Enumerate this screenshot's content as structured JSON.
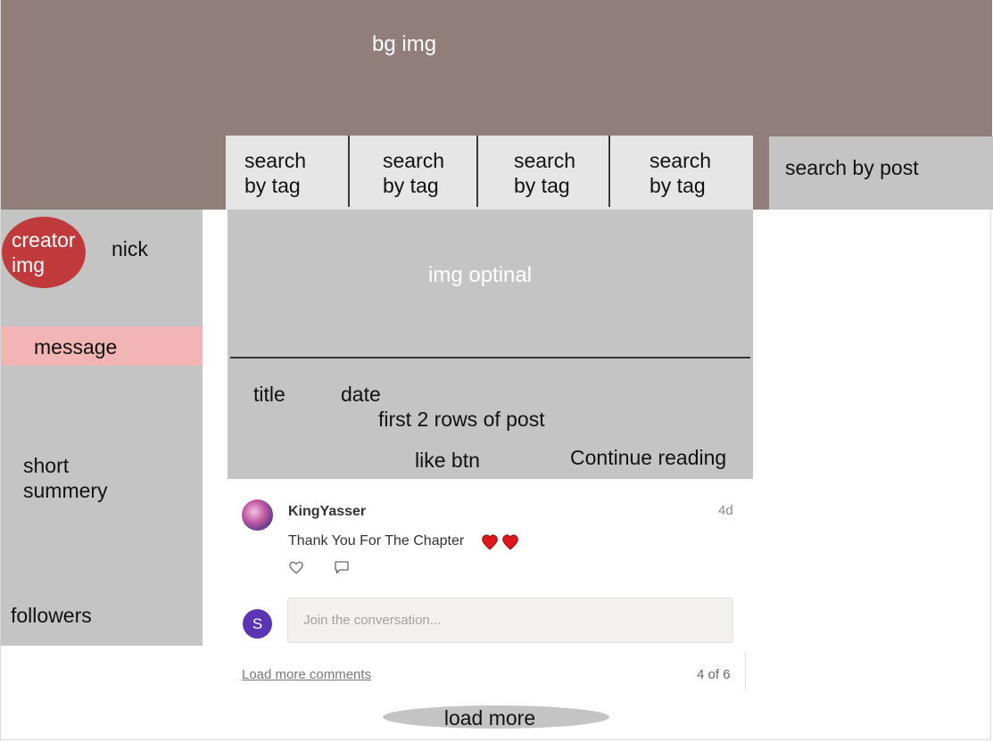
{
  "header": {
    "bg_label": "bg img"
  },
  "tag_searches": [
    {
      "line1": "search",
      "line2": "by tag"
    },
    {
      "line1": "search",
      "line2": "by tag"
    },
    {
      "line1": "search",
      "line2": "by tag"
    },
    {
      "line1": "search",
      "line2": "by tag"
    }
  ],
  "post_search": {
    "label": "search by post"
  },
  "sidebar": {
    "avatar_line1": "creator",
    "avatar_line2": "img",
    "nick": "nick",
    "message": "message",
    "summary_line1": "short",
    "summary_line2": "summery",
    "followers": "followers"
  },
  "post": {
    "image_label": "img optinal",
    "title": "title",
    "date": "date",
    "preview": "first 2 rows of post",
    "like": "like btn",
    "continue": "Continue reading"
  },
  "comment": {
    "author": "KingYasser",
    "time": "4d",
    "text": "Thank You For The Chapter",
    "hearts_icon": "red-heart-emoji"
  },
  "composer": {
    "avatar_initial": "S",
    "placeholder": "Join the conversation..."
  },
  "comments_footer": {
    "load_more": "Load more comments",
    "pager": "4 of 6"
  },
  "load_more": "load more",
  "colors": {
    "header_bg": "#917e7b",
    "panel_gray": "#c4c4c4",
    "tag_bg": "#e6e6e6",
    "avatar_red": "#c0393b",
    "message_pink": "#f2b4b4",
    "user_avatar": "#5b33b5"
  }
}
